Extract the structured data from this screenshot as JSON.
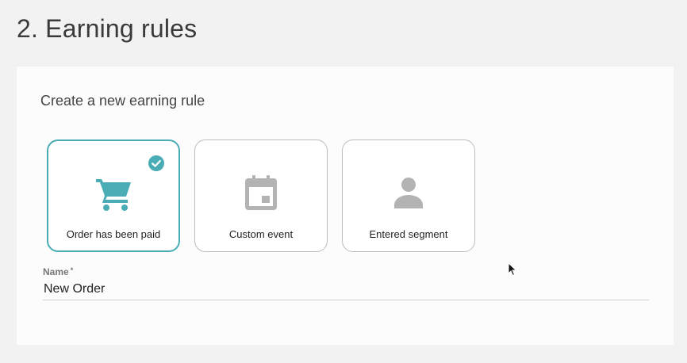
{
  "page": {
    "title": "2. Earning rules"
  },
  "panel": {
    "heading": "Create a new earning rule"
  },
  "rule_types": [
    {
      "label": "Order has been paid",
      "icon": "shopping-cart-icon",
      "selected": true
    },
    {
      "label": "Custom event",
      "icon": "calendar-icon",
      "selected": false
    },
    {
      "label": "Entered segment",
      "icon": "person-icon",
      "selected": false
    }
  ],
  "name_field": {
    "label": "Name",
    "required_mark": "*",
    "value": "New Order"
  },
  "colors": {
    "accent": "#4aadb5",
    "inactive_icon": "#b3b3b3",
    "border": "#bdbdbd"
  }
}
